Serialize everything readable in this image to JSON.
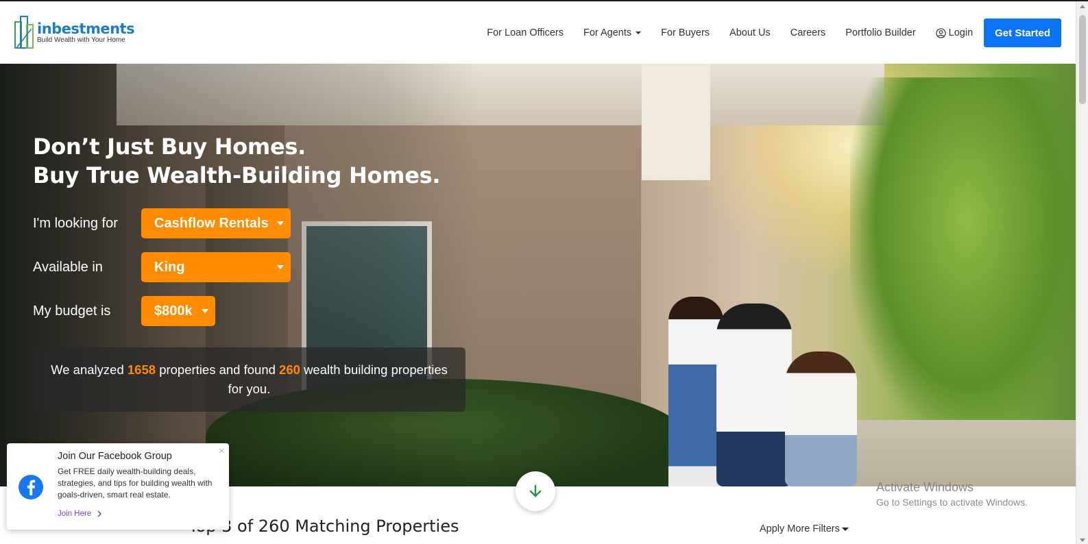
{
  "brand": {
    "name": "inbestments",
    "tagline": "Build Wealth with Your Home",
    "color": "#1e7cc0"
  },
  "nav": {
    "items": [
      {
        "label": "For Loan Officers"
      },
      {
        "label": "For Agents",
        "dropdown": true
      },
      {
        "label": "For Buyers"
      },
      {
        "label": "About Us"
      },
      {
        "label": "Careers"
      },
      {
        "label": "Portfolio Builder"
      }
    ],
    "login_label": "Login",
    "cta_label": "Get Started",
    "cta_color": "#0b74f4"
  },
  "hero": {
    "title_line1": "Don’t Just Buy Homes.",
    "title_line2": "Buy True Wealth-Building Homes.",
    "filters": [
      {
        "label": "I'm looking for",
        "value": "Cashflow Rentals"
      },
      {
        "label": "Available in",
        "value": "King"
      },
      {
        "label": "My budget is",
        "value": "$800k"
      }
    ],
    "accent_color": "#ff8c00",
    "result": {
      "prefix": "We analyzed",
      "analyzed_count": "1658",
      "middle": "properties and found",
      "found_count": "260",
      "suffix": "wealth building properties for you."
    }
  },
  "facebook_popup": {
    "title": "Join Our Facebook Group",
    "text": "Get FREE daily wealth-building deals, strategies, and tips for building wealth with goals-driven, smart real estate.",
    "link_label": "Join Here",
    "close_glyph": "×"
  },
  "listing": {
    "title": "Top 3 of 260 Matching Properties",
    "filters_label": "Apply More Filters"
  },
  "os_watermark": {
    "line1": "Activate Windows",
    "line2": "Go to Settings to activate Windows."
  }
}
